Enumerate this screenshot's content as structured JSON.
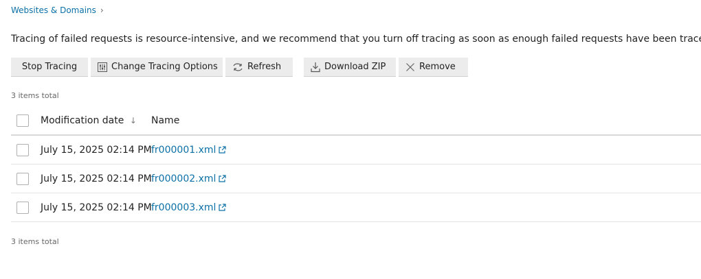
{
  "breadcrumb": {
    "label": "Websites & Domains",
    "chevron": "›"
  },
  "intro_text": "Tracing of failed requests is resource-intensive, and we recommend that you turn off tracing as soon as enough failed requests have been traced.",
  "toolbar": {
    "stop_label": "Stop Tracing",
    "change_label": "Change Tracing Options",
    "refresh_label": "Refresh",
    "zip_label": "Download ZIP",
    "remove_label": "Remove"
  },
  "items_total": "3 items total",
  "table": {
    "columns": {
      "date": "Modification date",
      "sort_indicator": "↓",
      "name": "Name"
    },
    "rows": [
      {
        "date": "July 15, 2025 02:14 PM",
        "name": "fr000001.xml"
      },
      {
        "date": "July 15, 2025 02:14 PM",
        "name": "fr000002.xml"
      },
      {
        "date": "July 15, 2025 02:14 PM",
        "name": "fr000003.xml"
      }
    ]
  },
  "colors": {
    "link": "#0b70a6",
    "button_bg": "#ececec"
  }
}
